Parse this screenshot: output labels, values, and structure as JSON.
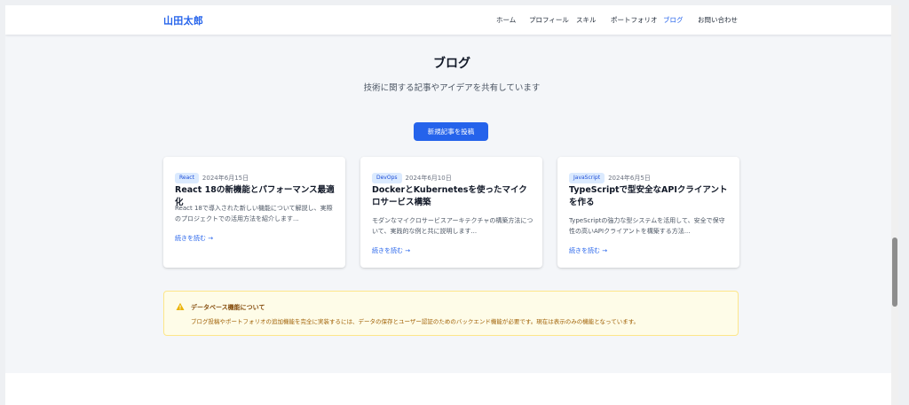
{
  "header": {
    "logo": "山田太郎",
    "nav": [
      {
        "label": "ホーム",
        "active": false
      },
      {
        "label": "プロフィール",
        "active": false
      },
      {
        "label": "スキル",
        "active": false
      },
      {
        "label": "ポートフォリオ",
        "active": false
      },
      {
        "label": "ブログ",
        "active": true
      },
      {
        "label": "お問い合わせ",
        "active": false
      }
    ]
  },
  "blog": {
    "title": "ブログ",
    "subtitle": "技術に関する記事やアイデアを共有しています",
    "new_post_label": "新規記事を投稿",
    "read_more_label": "続きを読む →",
    "posts": [
      {
        "tag": "React",
        "date": "2024年6月15日",
        "title": "React 18の新機能とパフォーマンス最適化",
        "excerpt": "React 18で導入された新しい機能について解説し、実際のプロジェクトでの活用方法を紹介します..."
      },
      {
        "tag": "DevOps",
        "date": "2024年6月10日",
        "title": "DockerとKubernetesを使ったマイクロサービス構築",
        "excerpt": "モダンなマイクロサービスアーキテクチャの構築方法について、実践的な例と共に説明します..."
      },
      {
        "tag": "JavaScript",
        "date": "2024年6月5日",
        "title": "TypeScriptで型安全なAPIクライアントを作る",
        "excerpt": "TypeScriptの強力な型システムを活用して、安全で保守性の高いAPIクライアントを構築する方法..."
      }
    ]
  },
  "notice": {
    "icon": "warning-icon",
    "title": "データベース機能について",
    "body": "ブログ投稿やポートフォリオの追加機能を完全に実装するには、データの保存とユーザー認証のためのバックエンド機能が必要です。現在は表示のみの機能となっています。"
  },
  "colors": {
    "accent": "#2563eb",
    "background": "#f4f6f9",
    "notice_bg": "#fefce8",
    "notice_border": "#fde68a",
    "tag_bg": "#dbeafe"
  }
}
